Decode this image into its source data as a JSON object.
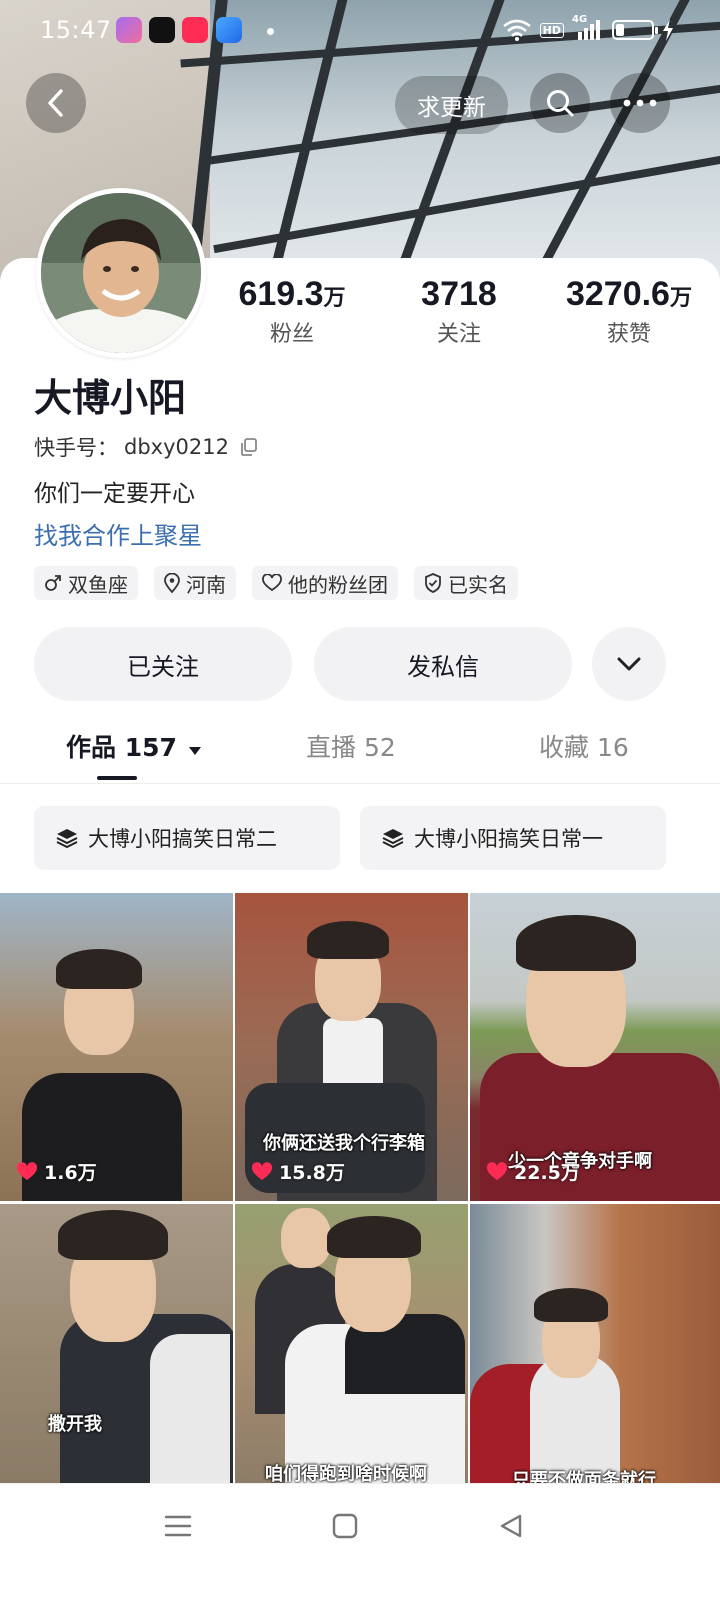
{
  "status_bar": {
    "time": "15:47",
    "hd": "HD",
    "network": "4G"
  },
  "nav": {
    "request_update": "求更新"
  },
  "profile": {
    "name": "大博小阳",
    "handle_label": "快手号：",
    "handle_value": "dbxy0212",
    "bio": "你们一定要开心",
    "cooperation_link": "找我合作上聚星",
    "stats": [
      {
        "value": "619.3",
        "unit": "万",
        "label": "粉丝"
      },
      {
        "value": "3718",
        "unit": "",
        "label": "关注"
      },
      {
        "value": "3270.6",
        "unit": "万",
        "label": "获赞"
      }
    ],
    "tags": [
      {
        "icon": "male-icon",
        "label": "双鱼座"
      },
      {
        "icon": "location-icon",
        "label": "河南"
      },
      {
        "icon": "heart-outline-icon",
        "label": "他的粉丝团"
      },
      {
        "icon": "shield-check-icon",
        "label": "已实名"
      }
    ]
  },
  "actions": {
    "followed": "已关注",
    "message": "发私信"
  },
  "tabs": [
    {
      "label": "作品 157",
      "active": true
    },
    {
      "label": "直播 52",
      "active": false
    },
    {
      "label": "收藏 16",
      "active": false
    }
  ],
  "collections": [
    {
      "label": "大博小阳搞笑日常二"
    },
    {
      "label": "大博小阳搞笑日常一"
    }
  ],
  "videos": [
    {
      "caption": "",
      "likes": "1.6万"
    },
    {
      "caption": "你俩还送我个行李箱",
      "likes": "15.8万"
    },
    {
      "caption": "少一个竞争对手啊",
      "likes": "22.5万"
    },
    {
      "caption": "撒开我",
      "likes": ""
    },
    {
      "caption": "咱们得跑到啥时候啊",
      "likes": ""
    },
    {
      "caption": "只要不做面条就行",
      "likes": ""
    }
  ],
  "colors": {
    "link": "#3b6fb0",
    "heart": "#fe2c55",
    "text_primary": "#161823"
  }
}
